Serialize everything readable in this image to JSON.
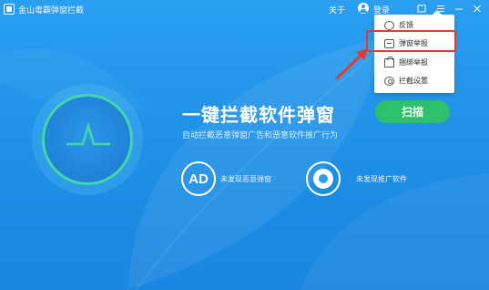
{
  "window": {
    "title": "金山毒霸弹窗拦截",
    "about": "关于",
    "login": "登录",
    "controls": {
      "skin_icon": "skin-icon",
      "menu_icon": "menu-icon",
      "minimize_icon": "minimize-icon",
      "close_icon": "close-icon"
    }
  },
  "menu": {
    "items": [
      {
        "label": "反馈",
        "icon": "feedback-icon"
      },
      {
        "label": "弹窗举报",
        "icon": "report-icon"
      },
      {
        "label": "捆绑举报",
        "icon": "bundle-icon"
      },
      {
        "label": "拦截设置",
        "icon": "settings-icon"
      }
    ]
  },
  "main": {
    "headline": "一键拦截软件弹窗",
    "subline": "自动拦截恶意弹窗广告和恶意软件推广行为",
    "scan_button": "扫描"
  },
  "stats": [
    {
      "badge": "AD",
      "label": "未发现恶意弹窗"
    },
    {
      "badge_icon": "disc-icon",
      "label": "未发现推广软件"
    }
  ],
  "colors": {
    "background": "#2a9ff0",
    "accent_green": "#2fc06b",
    "gauge_ring": "#43d6a8",
    "highlight_red": "#e53935"
  }
}
